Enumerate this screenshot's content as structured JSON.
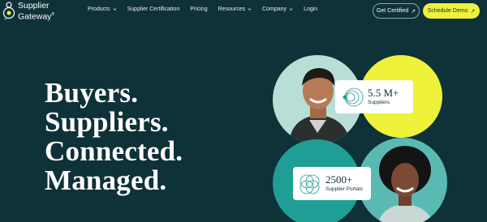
{
  "brand": {
    "name_line1": "Supplier",
    "name_line2": "Gateway",
    "trademark": "®"
  },
  "nav": {
    "items": [
      {
        "label": "Products",
        "has_dropdown": true
      },
      {
        "label": "Supplier Certification",
        "has_dropdown": false
      },
      {
        "label": "Pricing",
        "has_dropdown": false
      },
      {
        "label": "Resources",
        "has_dropdown": true
      },
      {
        "label": "Company",
        "has_dropdown": true
      },
      {
        "label": "Login",
        "has_dropdown": false
      }
    ]
  },
  "cta": {
    "get_certified": "Get Certified",
    "schedule_demo": "Schedule Demo",
    "arrow_glyph": "↗"
  },
  "hero": {
    "lines": [
      "Buyers.",
      "Suppliers.",
      "Connected.",
      "Managed."
    ]
  },
  "stats": [
    {
      "number": "5.5 M+",
      "label": "Suppliers"
    },
    {
      "number": "2500+",
      "label": "Supplier Portals"
    }
  ],
  "colors": {
    "background": "#0f3138",
    "accent_yellow": "#eef23a",
    "teal": "#1f9e96",
    "mint": "#b8dfd6"
  },
  "icons": [
    "logo-mark-icon",
    "chevron-down-icon",
    "arrow-up-right-icon",
    "concentric-circles-icon",
    "overlapping-circles-icon"
  ]
}
